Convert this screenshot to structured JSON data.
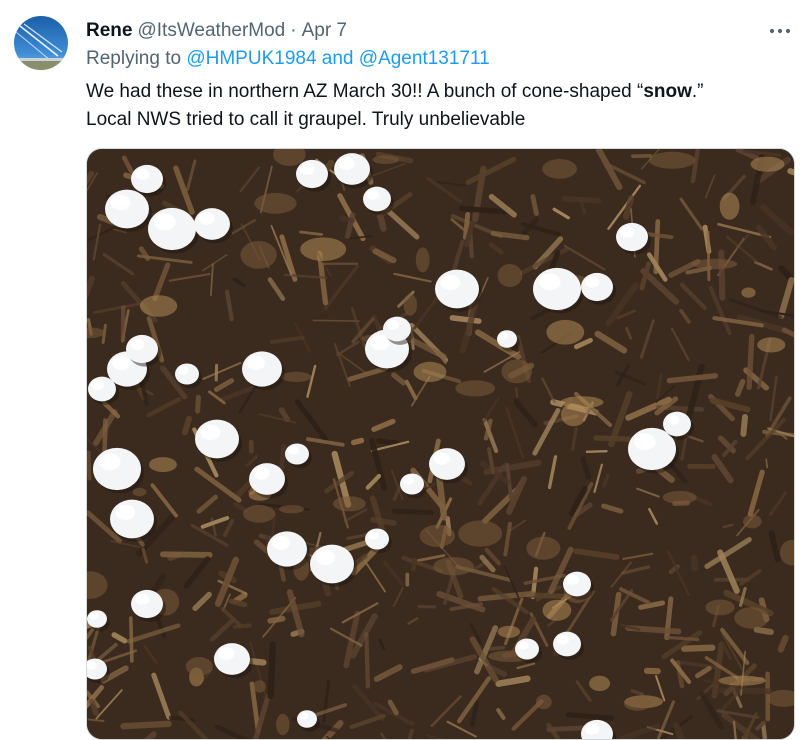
{
  "tweet": {
    "display_name": "Rene",
    "handle": "@ItsWeatherMod",
    "separator": "·",
    "date": "Apr 7",
    "replying_prefix": "Replying to",
    "mention_1": "@HMPUK1984",
    "mention_joiner": "and",
    "mention_2": "@Agent131711",
    "text_line1_before": "We had these in northern AZ March 30!! A bunch of cone-shaped “",
    "text_line1_bold": "snow",
    "text_line1_after": ".”",
    "text_line2": "Local NWS tried to call it graupel. Truly unbelievable",
    "more_icon": "ellipsis-icon",
    "avatar_icon": "avatar-sky-contrails",
    "photo": "graupel-on-mulch-photo"
  },
  "colors": {
    "link": "#1d9bf0",
    "secondary_text": "#536471",
    "primary_text": "#0f1419",
    "border": "#cfd9de"
  }
}
